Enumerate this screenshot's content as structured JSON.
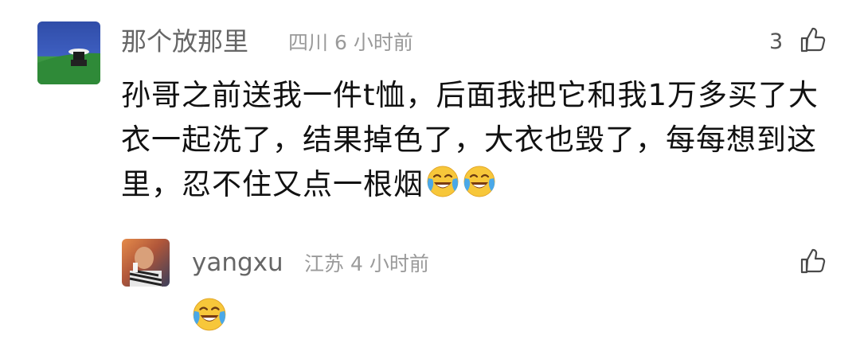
{
  "comment": {
    "username": "那个放那里",
    "location": "四川",
    "time": "6 小时前",
    "like_count": "3",
    "text": "孙哥之前送我一件t恤，后面我把它和我1万多买了大衣一起洗了，结果掉色了，大衣也毁了，每每想到这里，忍不住又点一根烟",
    "emoji": [
      "laugh-cry-emoji",
      "laugh-cry-emoji"
    ]
  },
  "reply": {
    "username": "yangxu",
    "location": "江苏",
    "time": "4 小时前",
    "emoji": "laugh-cry-emoji"
  }
}
